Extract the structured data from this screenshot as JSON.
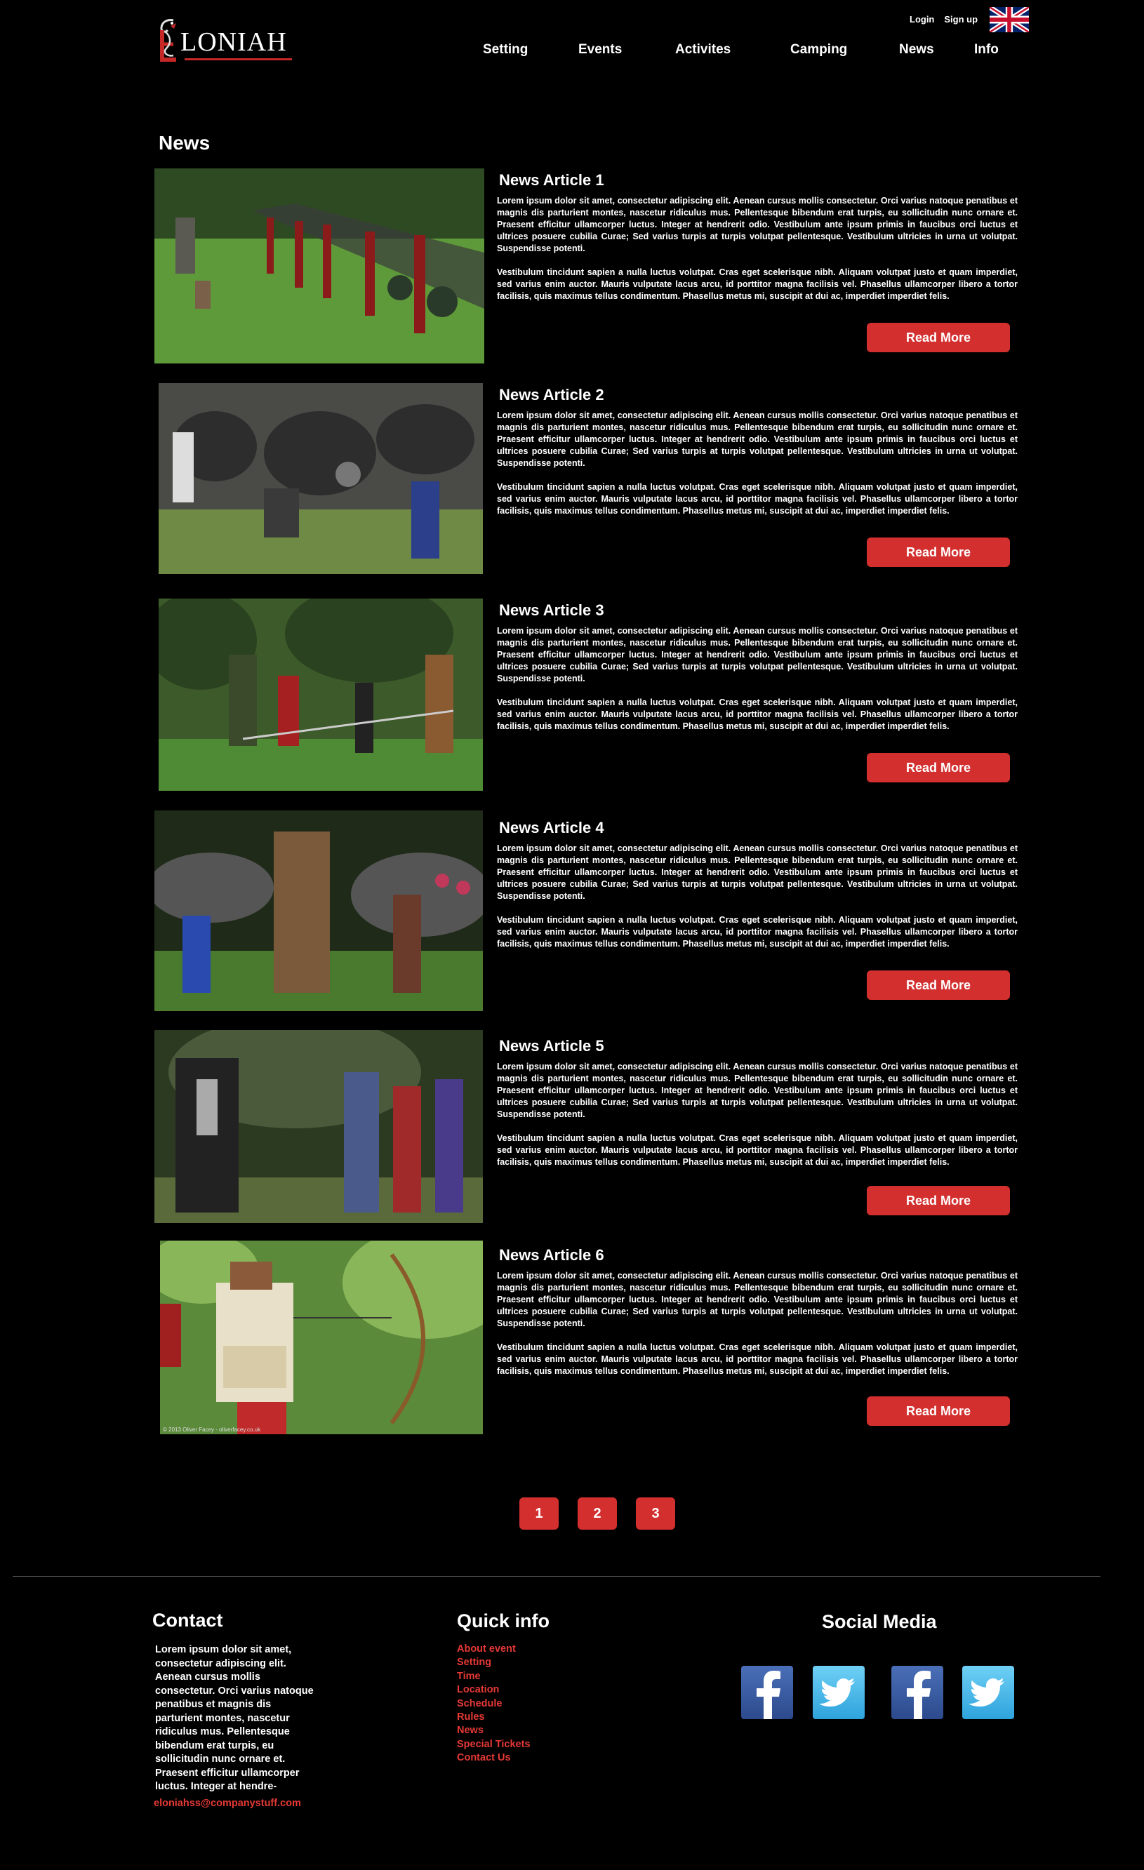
{
  "brand": {
    "logo_text": "LONIAH"
  },
  "auth": {
    "login": "Login",
    "signup": "Sign up"
  },
  "nav": {
    "items": [
      "Setting",
      "Events",
      "Activites",
      "Camping",
      "News",
      "Info"
    ]
  },
  "page": {
    "title": "News"
  },
  "articles": [
    {
      "title": "News Article 1",
      "p1": "Lorem ipsum dolor sit amet, consectetur adipiscing elit. Aenean cursus mollis consectetur. Orci varius natoque penatibus et magnis dis parturient montes, nascetur ridiculus mus. Pellentesque bibendum erat turpis, eu sollicitudin nunc ornare et. Praesent efficitur ullamcorper luctus. Integer at hendrerit odio. Vestibulum ante ipsum primis in faucibus orci luctus et ultrices posuere cubilia Curae; Sed varius turpis at turpis volutpat pellentesque. Vestibulum ultricies in urna ut volutpat. Suspendisse potenti.",
      "p2": "Vestibulum tincidunt sapien a nulla luctus volutpat. Cras eget scelerisque nibh. Aliquam volutpat justo et quam imperdiet, sed varius enim auctor. Mauris vulputate lacus arcu, id porttitor magna facilisis vel. Phasellus ullamcorper libero a tortor facilisis, quis maximus tellus condimentum. Phasellus metus mi, suscipit at dui ac, imperdiet imperdiet felis.",
      "button": "Read More"
    },
    {
      "title": "News Article 2",
      "p1": "Lorem ipsum dolor sit amet, consectetur adipiscing elit. Aenean cursus mollis consectetur. Orci varius natoque penatibus et magnis dis parturient montes, nascetur ridiculus mus. Pellentesque bibendum erat turpis, eu sollicitudin nunc ornare et. Praesent efficitur ullamcorper luctus. Integer at hendrerit odio. Vestibulum ante ipsum primis in faucibus orci luctus et ultrices posuere cubilia Curae; Sed varius turpis at turpis volutpat pellentesque. Vestibulum ultricies in urna ut volutpat. Suspendisse potenti.",
      "p2": "Vestibulum tincidunt sapien a nulla luctus volutpat. Cras eget scelerisque nibh. Aliquam volutpat justo et quam imperdiet, sed varius enim auctor. Mauris vulputate lacus arcu, id porttitor magna facilisis vel. Phasellus ullamcorper libero a tortor facilisis, quis maximus tellus condimentum. Phasellus metus mi, suscipit at dui ac, imperdiet imperdiet felis.",
      "button": "Read More"
    },
    {
      "title": "News Article 3",
      "p1": "Lorem ipsum dolor sit amet, consectetur adipiscing elit. Aenean cursus mollis consectetur. Orci varius natoque penatibus et magnis dis parturient montes, nascetur ridiculus mus. Pellentesque bibendum erat turpis, eu sollicitudin nunc ornare et. Praesent efficitur ullamcorper luctus. Integer at hendrerit odio. Vestibulum ante ipsum primis in faucibus orci luctus et ultrices posuere cubilia Curae; Sed varius turpis at turpis volutpat pellentesque. Vestibulum ultricies in urna ut volutpat. Suspendisse potenti.",
      "p2": "Vestibulum tincidunt sapien a nulla luctus volutpat. Cras eget scelerisque nibh. Aliquam volutpat justo et quam imperdiet, sed varius enim auctor. Mauris vulputate lacus arcu, id porttitor magna facilisis vel. Phasellus ullamcorper libero a tortor facilisis, quis maximus tellus condimentum. Phasellus metus mi, suscipit at dui ac, imperdiet imperdiet felis.",
      "button": "Read More"
    },
    {
      "title": "News Article 4",
      "p1": "Lorem ipsum dolor sit amet, consectetur adipiscing elit. Aenean cursus mollis consectetur. Orci varius natoque penatibus et magnis dis parturient montes, nascetur ridiculus mus. Pellentesque bibendum erat turpis, eu sollicitudin nunc ornare et. Praesent efficitur ullamcorper luctus. Integer at hendrerit odio. Vestibulum ante ipsum primis in faucibus orci luctus et ultrices posuere cubilia Curae; Sed varius turpis at turpis volutpat pellentesque. Vestibulum ultricies in urna ut volutpat. Suspendisse potenti.",
      "p2": "Vestibulum tincidunt sapien a nulla luctus volutpat. Cras eget scelerisque nibh. Aliquam volutpat justo et quam imperdiet, sed varius enim auctor. Mauris vulputate lacus arcu, id porttitor magna facilisis vel. Phasellus ullamcorper libero a tortor facilisis, quis maximus tellus condimentum. Phasellus metus mi, suscipit at dui ac, imperdiet imperdiet felis.",
      "button": "Read More"
    },
    {
      "title": "News Article 5",
      "p1": "Lorem ipsum dolor sit amet, consectetur adipiscing elit. Aenean cursus mollis consectetur. Orci varius natoque penatibus et magnis dis parturient montes, nascetur ridiculus mus. Pellentesque bibendum erat turpis, eu sollicitudin nunc ornare et. Praesent efficitur ullamcorper luctus. Integer at hendrerit odio. Vestibulum ante ipsum primis in faucibus orci luctus et ultrices posuere cubilia Curae; Sed varius turpis at turpis volutpat pellentesque. Vestibulum ultricies in urna ut volutpat. Suspendisse potenti.",
      "p2": "Vestibulum tincidunt sapien a nulla luctus volutpat. Cras eget scelerisque nibh. Aliquam volutpat justo et quam imperdiet, sed varius enim auctor. Mauris vulputate lacus arcu, id porttitor magna facilisis vel. Phasellus ullamcorper libero a tortor facilisis, quis maximus tellus condimentum. Phasellus metus mi, suscipit at dui ac, imperdiet imperdiet felis.",
      "button": "Read More"
    },
    {
      "title": "News Article 6",
      "p1": "Lorem ipsum dolor sit amet, consectetur adipiscing elit. Aenean cursus mollis consectetur. Orci varius natoque penatibus et magnis dis parturient montes, nascetur ridiculus mus. Pellentesque bibendum erat turpis, eu sollicitudin nunc ornare et. Praesent efficitur ullamcorper luctus. Integer at hendrerit odio. Vestibulum ante ipsum primis in faucibus orci luctus et ultrices posuere cubilia Curae; Sed varius turpis at turpis volutpat pellentesque. Vestibulum ultricies in urna ut volutpat. Suspendisse potenti.",
      "p2": "Vestibulum tincidunt sapien a nulla luctus volutpat. Cras eget scelerisque nibh. Aliquam volutpat justo et quam imperdiet, sed varius enim auctor. Mauris vulputate lacus arcu, id porttitor magna facilisis vel. Phasellus ullamcorper libero a tortor facilisis, quis maximus tellus condimentum. Phasellus metus mi, suscipit at dui ac, imperdiet imperdiet felis.",
      "button": "Read More"
    }
  ],
  "pagination": {
    "pages": [
      "1",
      "2",
      "3"
    ]
  },
  "footer": {
    "contact": {
      "heading": "Contact",
      "text": "Lorem ipsum dolor sit amet, consectetur adipiscing elit. Aenean cursus mollis consectetur. Orci varius natoque penatibus et magnis dis parturient montes, nascetur ridiculus mus. Pellentesque bibendum erat turpis, eu sollicitudin nunc ornare et. Praesent efficitur ullamcorper luctus. Integer at hendre-",
      "email": "eloniahss@companystuff.com"
    },
    "quick_info": {
      "heading": "Quick info",
      "links": [
        "About event",
        "Setting",
        "Time",
        "Location",
        "Schedule",
        "Rules",
        "News",
        "Special Tickets",
        "Contact Us"
      ]
    },
    "social": {
      "heading": "Social Media",
      "icons": [
        "facebook-icon",
        "twitter-icon",
        "facebook-icon",
        "twitter-icon"
      ]
    }
  },
  "colors": {
    "accent": "#d32f2f",
    "link": "#e53935",
    "background": "#000000",
    "facebook": "#3b5998",
    "twitter": "#3fb5ea"
  },
  "thumbnail_caption": "© 2013 Oliver Facey - oliverfacey.co.uk"
}
